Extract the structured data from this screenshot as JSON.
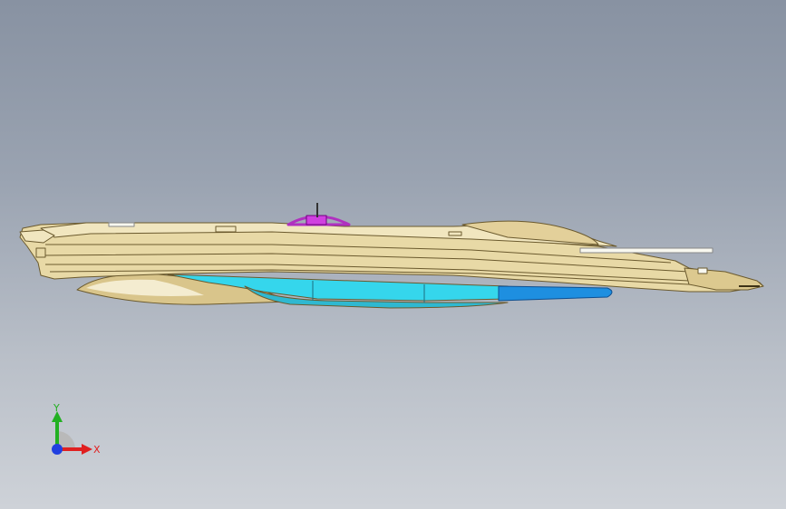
{
  "viewport": {
    "background_top": "#8892a2",
    "background_bottom": "#ced2d8"
  },
  "model": {
    "body_color": "#e8d9a6",
    "edge_color": "#6b5a2e",
    "pipe_color": "#35d6ec",
    "tank_color": "#1e8fe0",
    "hatch_color": "#b030c0"
  },
  "triad": {
    "x_label": "X",
    "y_label": "Y",
    "x_color": "#e02020",
    "y_color": "#22b022",
    "z_color": "#2040e0"
  }
}
